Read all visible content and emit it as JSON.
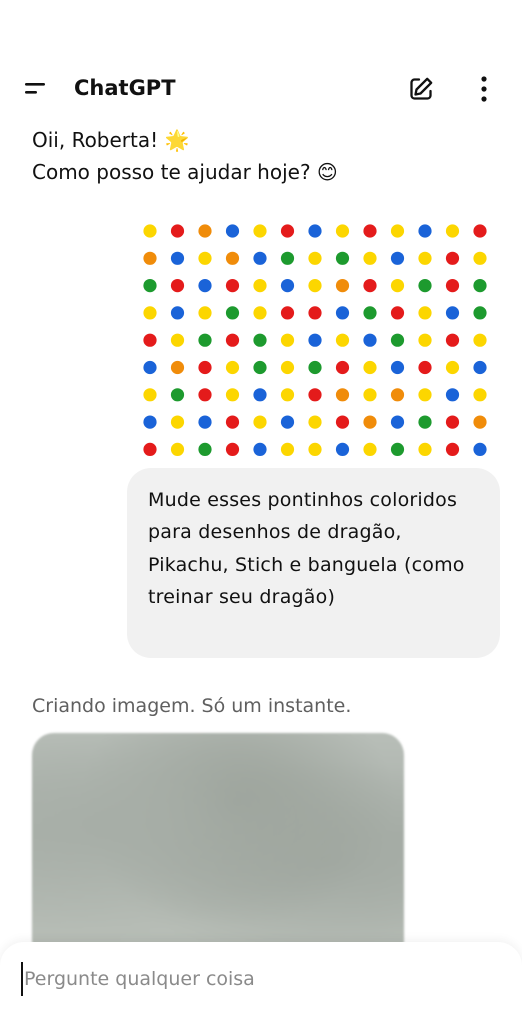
{
  "header": {
    "title": "ChatGPT",
    "menu_icon": "menu-icon",
    "new_chat_icon": "edit-icon",
    "more_icon": "more-vertical-icon"
  },
  "greeting": {
    "line1": "Oii, Roberta! 🌟",
    "line2": "Como posso te ajudar hoje? 😊"
  },
  "user_message": {
    "text": "Mude esses pontinhos coloridos para desenhos de dragão, Pikachu, Stich e banguela (como treinar seu dragão)"
  },
  "status": {
    "text": "Criando imagem. Só um instante."
  },
  "composer": {
    "placeholder": "Pergunte qualquer coisa"
  },
  "colors": {
    "yellow": "#fcd600",
    "red": "#e41b1b",
    "blue": "#1a63d8",
    "green": "#1d9a2e",
    "orange": "#f08c0a"
  },
  "dot_grid": [
    [
      "y",
      "r",
      "o",
      "b",
      "y",
      "r",
      "b",
      "y",
      "r",
      "y",
      "b",
      "y",
      "r"
    ],
    [
      "o",
      "b",
      "y",
      "o",
      "b",
      "g",
      "y",
      "g",
      "y",
      "b",
      "y",
      "r",
      "y"
    ],
    [
      "g",
      "r",
      "b",
      "r",
      "y",
      "b",
      "y",
      "o",
      "r",
      "y",
      "g",
      "r",
      "g"
    ],
    [
      "y",
      "b",
      "y",
      "g",
      "y",
      "r",
      "r",
      "b",
      "g",
      "r",
      "y",
      "b",
      "g"
    ],
    [
      "r",
      "y",
      "g",
      "r",
      "g",
      "y",
      "b",
      "y",
      "b",
      "g",
      "y",
      "r",
      "y"
    ],
    [
      "b",
      "o",
      "r",
      "y",
      "g",
      "y",
      "g",
      "r",
      "y",
      "b",
      "r",
      "y",
      "b"
    ],
    [
      "y",
      "g",
      "r",
      "y",
      "b",
      "y",
      "r",
      "o",
      "y",
      "o",
      "y",
      "b",
      "y"
    ],
    [
      "b",
      "y",
      "b",
      "r",
      "y",
      "b",
      "y",
      "r",
      "o",
      "b",
      "g",
      "r",
      "o"
    ],
    [
      "r",
      "y",
      "g",
      "r",
      "b",
      "y",
      "y",
      "b",
      "y",
      "g",
      "y",
      "r",
      "b"
    ]
  ]
}
